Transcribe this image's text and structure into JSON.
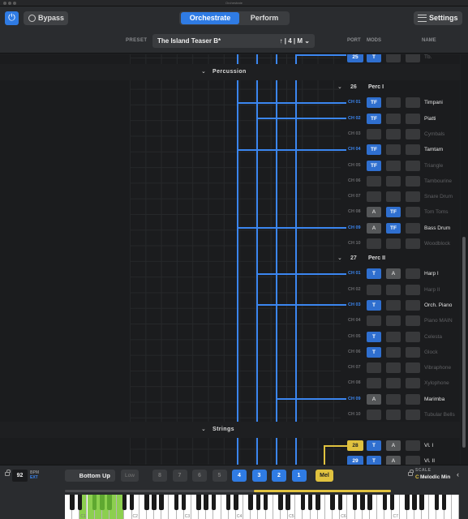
{
  "window": {
    "title": "Orchestrate"
  },
  "toolbar": {
    "bypass_label": "Bypass",
    "modes": [
      {
        "label": "Orchestrate",
        "active": true
      },
      {
        "label": "Perform",
        "active": false
      }
    ],
    "settings_label": "Settings",
    "preset_label": "PRESET",
    "preset_value": "The Island Teaser B*",
    "preset_nav": "↑ | 4 | M",
    "columns": {
      "port": "PORT",
      "mods": "MODS",
      "name": "NAME"
    }
  },
  "sections": {
    "percussion": "Percussion",
    "strings": "Strings"
  },
  "top_partial": {
    "port": "25",
    "mod": "T",
    "name": "Tb."
  },
  "groups": [
    {
      "port": "26",
      "name": "Perc I",
      "rows": [
        {
          "ch": "CH 01",
          "active": true,
          "m1": "TF",
          "m2": "",
          "name": "Timpani"
        },
        {
          "ch": "CH 02",
          "active": true,
          "m1": "TF",
          "m2": "",
          "name": "Piatti"
        },
        {
          "ch": "CH 03",
          "active": false,
          "m1": "",
          "m2": "",
          "name": "Cymbals"
        },
        {
          "ch": "CH 04",
          "active": true,
          "m1": "TF",
          "m2": "",
          "name": "Tamtam"
        },
        {
          "ch": "CH 05",
          "active": false,
          "m1": "TF",
          "m2": "",
          "name": "Triangle"
        },
        {
          "ch": "CH 06",
          "active": false,
          "m1": "",
          "m2": "",
          "name": "Tambourine"
        },
        {
          "ch": "CH 07",
          "active": false,
          "m1": "",
          "m2": "",
          "name": "Snare Drum"
        },
        {
          "ch": "CH 08",
          "active": false,
          "m1": "A",
          "m2": "TF",
          "name": "Tom Toms"
        },
        {
          "ch": "CH 09",
          "active": true,
          "m1": "A",
          "m2": "TF",
          "name": "Bass Drum"
        },
        {
          "ch": "CH 10",
          "active": false,
          "m1": "",
          "m2": "",
          "name": "Woodblock"
        }
      ]
    },
    {
      "port": "27",
      "name": "Perc II",
      "rows": [
        {
          "ch": "CH 01",
          "active": true,
          "m1": "T",
          "m2": "A",
          "name": "Harp I"
        },
        {
          "ch": "CH 02",
          "active": false,
          "m1": "",
          "m2": "",
          "name": "Harp II"
        },
        {
          "ch": "CH 03",
          "active": true,
          "m1": "T",
          "m2": "",
          "name": "Orch. Piano"
        },
        {
          "ch": "CH 04",
          "active": false,
          "m1": "",
          "m2": "",
          "name": "Piano MAIN"
        },
        {
          "ch": "CH 05",
          "active": false,
          "m1": "T",
          "m2": "",
          "name": "Celesta"
        },
        {
          "ch": "CH 06",
          "active": false,
          "m1": "T",
          "m2": "",
          "name": "Glock"
        },
        {
          "ch": "CH 07",
          "active": false,
          "m1": "",
          "m2": "",
          "name": "Vibraphone"
        },
        {
          "ch": "CH 08",
          "active": false,
          "m1": "",
          "m2": "",
          "name": "Xylophone"
        },
        {
          "ch": "CH 09",
          "active": true,
          "m1": "A",
          "m2": "",
          "name": "Marimba"
        },
        {
          "ch": "CH 10",
          "active": false,
          "m1": "",
          "m2": "",
          "name": "Tubular Bells"
        }
      ]
    }
  ],
  "strings_rows": [
    {
      "port": "28",
      "m1": "T",
      "m2": "A",
      "name": "Vl. I"
    },
    {
      "port": "29",
      "m1": "T",
      "m2": "A",
      "name": "Vl. II"
    }
  ],
  "bottom": {
    "bpm": "92",
    "bpm_label": "BPM",
    "bpm_source": "EXT",
    "voicing": "Bottom Up",
    "low_label": "Low",
    "voices": [
      "8",
      "7",
      "6",
      "5",
      "4",
      "3",
      "2",
      "1"
    ],
    "active_voices": [
      "4",
      "3",
      "2",
      "1"
    ],
    "mel_label": "Mel",
    "scale_label": "SCALE",
    "scale_key": "C",
    "scale_value": "Melodic Min",
    "range_fraction": [
      0.58,
      1.0
    ],
    "octave_labels": [
      "C1",
      "C2",
      "C3",
      "C4",
      "C5",
      "C6",
      "C7"
    ]
  },
  "colors": {
    "accent": "#2f7be3",
    "wire": "#3b86f0",
    "highlight": "#e0c23f",
    "key_highlight": "#8ccf4f"
  }
}
